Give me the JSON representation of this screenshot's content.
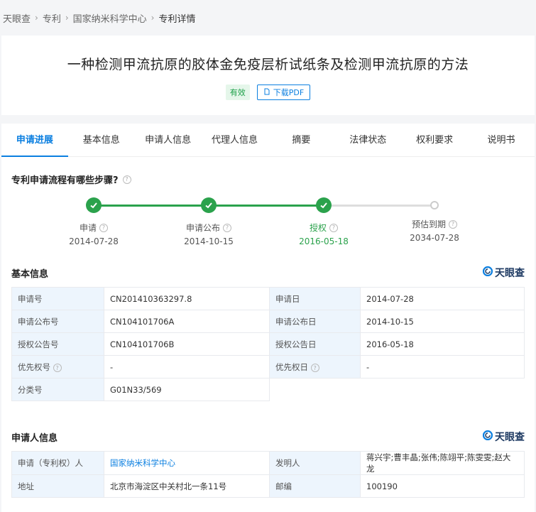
{
  "breadcrumb": [
    "天眼查",
    "专利",
    "国家纳米科学中心",
    "专利详情"
  ],
  "patent": {
    "title": "一种检测甲流抗原的胶体金免疫层析试纸条及检测甲流抗原的方法",
    "status": "有效",
    "download_label": "下载PDF"
  },
  "tabs": [
    "申请进展",
    "基本信息",
    "申请人信息",
    "代理人信息",
    "摘要",
    "法律状态",
    "权利要求",
    "说明书"
  ],
  "progress": {
    "question": "专利申请流程有哪些步骤?",
    "steps": [
      {
        "label": "申请",
        "date": "2014-07-28",
        "state": "done"
      },
      {
        "label": "申请公布",
        "date": "2014-10-15",
        "state": "done"
      },
      {
        "label": "授权",
        "date": "2016-05-18",
        "state": "current"
      },
      {
        "label": "预估到期",
        "date": "2034-07-28",
        "state": "pending"
      }
    ]
  },
  "brand_name": "天眼查",
  "basic_info": {
    "title": "基本信息",
    "rows": [
      [
        "申请号",
        "CN201410363297.8",
        "申请日",
        "2014-07-28"
      ],
      [
        "申请公布号",
        "CN104101706A",
        "申请公布日",
        "2014-10-15"
      ],
      [
        "授权公告号",
        "CN104101706B",
        "授权公告日",
        "2016-05-18"
      ],
      [
        "优先权号",
        "-",
        "优先权日",
        "-"
      ]
    ],
    "class_label": "分类号",
    "class_value": "G01N33/569"
  },
  "applicant_info": {
    "title": "申请人信息",
    "applicant_label": "申请（专利权）人",
    "applicant_value": "国家纳米科学中心",
    "inventor_label": "发明人",
    "inventor_value": "蒋兴宇;曹丰晶;张伟;陈翊平;陈雯雯;赵大龙",
    "address_label": "地址",
    "address_value": "北京市海淀区中关村北一条11号",
    "zip_label": "邮编",
    "zip_value": "100190"
  },
  "colors": {
    "accent": "#0b7fe0",
    "success": "#2ba24c",
    "label_bg": "#edf5fd"
  }
}
